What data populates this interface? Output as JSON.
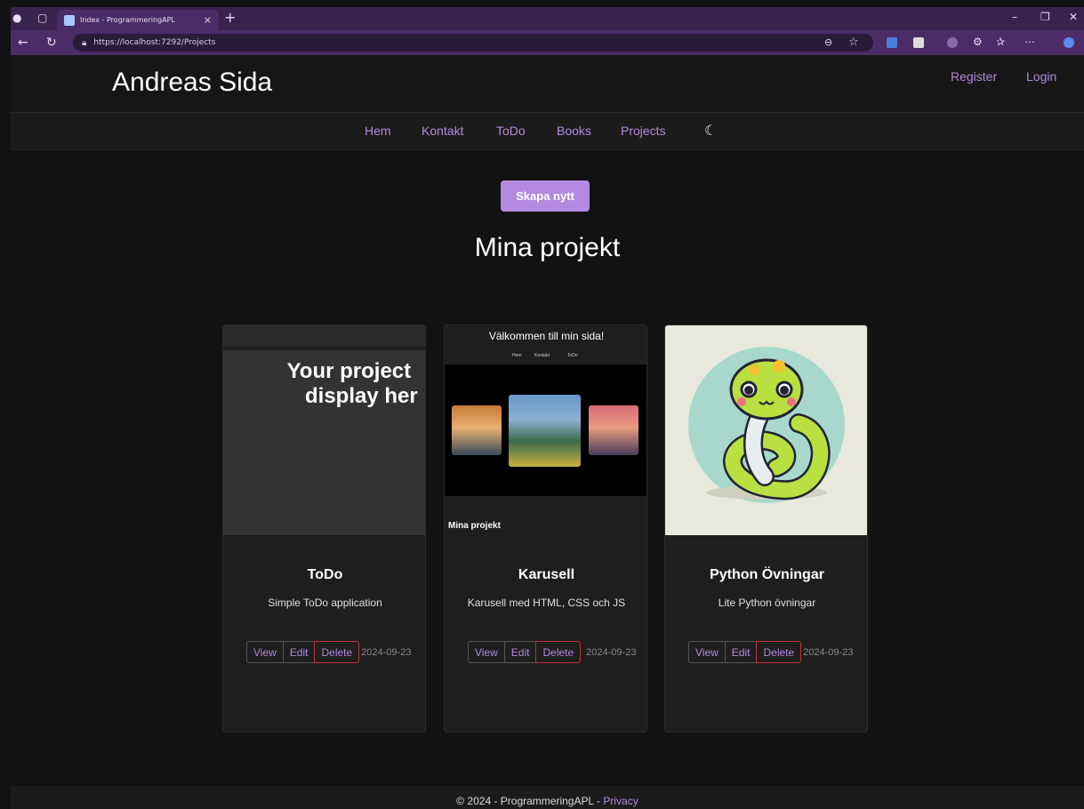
{
  "browser": {
    "tab_title": "Index - ProgrammeringAPL",
    "tab_close": "×",
    "new_tab": "+",
    "url": "https://localhost:7292/Projects",
    "accent": "#4b2c66"
  },
  "header": {
    "brand": "Andreas Sida",
    "register": "Register",
    "login": "Login"
  },
  "nav": {
    "items": [
      "Hem",
      "Kontakt",
      "ToDo",
      "Books",
      "Projects"
    ],
    "theme_icon": "moon-icon"
  },
  "main": {
    "create_button": "Skapa nytt",
    "title": "Mina projekt"
  },
  "cards": [
    {
      "title": "ToDo",
      "description": "Simple ToDo application",
      "view": "View",
      "edit": "Edit",
      "delete": "Delete",
      "date": "2024-09-23",
      "image_text_1": "Your project",
      "image_text_2": "display her"
    },
    {
      "title": "Karusell",
      "description": "Karusell med HTML, CSS och JS",
      "view": "View",
      "edit": "Edit",
      "delete": "Delete",
      "date": "2024-09-23",
      "image_welcome": "Välkommen till min sida!",
      "image_nav": [
        "Hem",
        "Kontakt",
        "ToDo"
      ],
      "image_subtitle": "Mina projekt"
    },
    {
      "title": "Python Övningar",
      "description": "Lite Python övningar",
      "view": "View",
      "edit": "Edit",
      "delete": "Delete",
      "date": "2024-09-23"
    }
  ],
  "footer": {
    "text": "© 2024 - ProgrammeringAPL - ",
    "privacy": "Privacy"
  },
  "colors": {
    "accent_purple": "#b48ae0",
    "delete_border": "#c0303a",
    "background": "#121212"
  }
}
